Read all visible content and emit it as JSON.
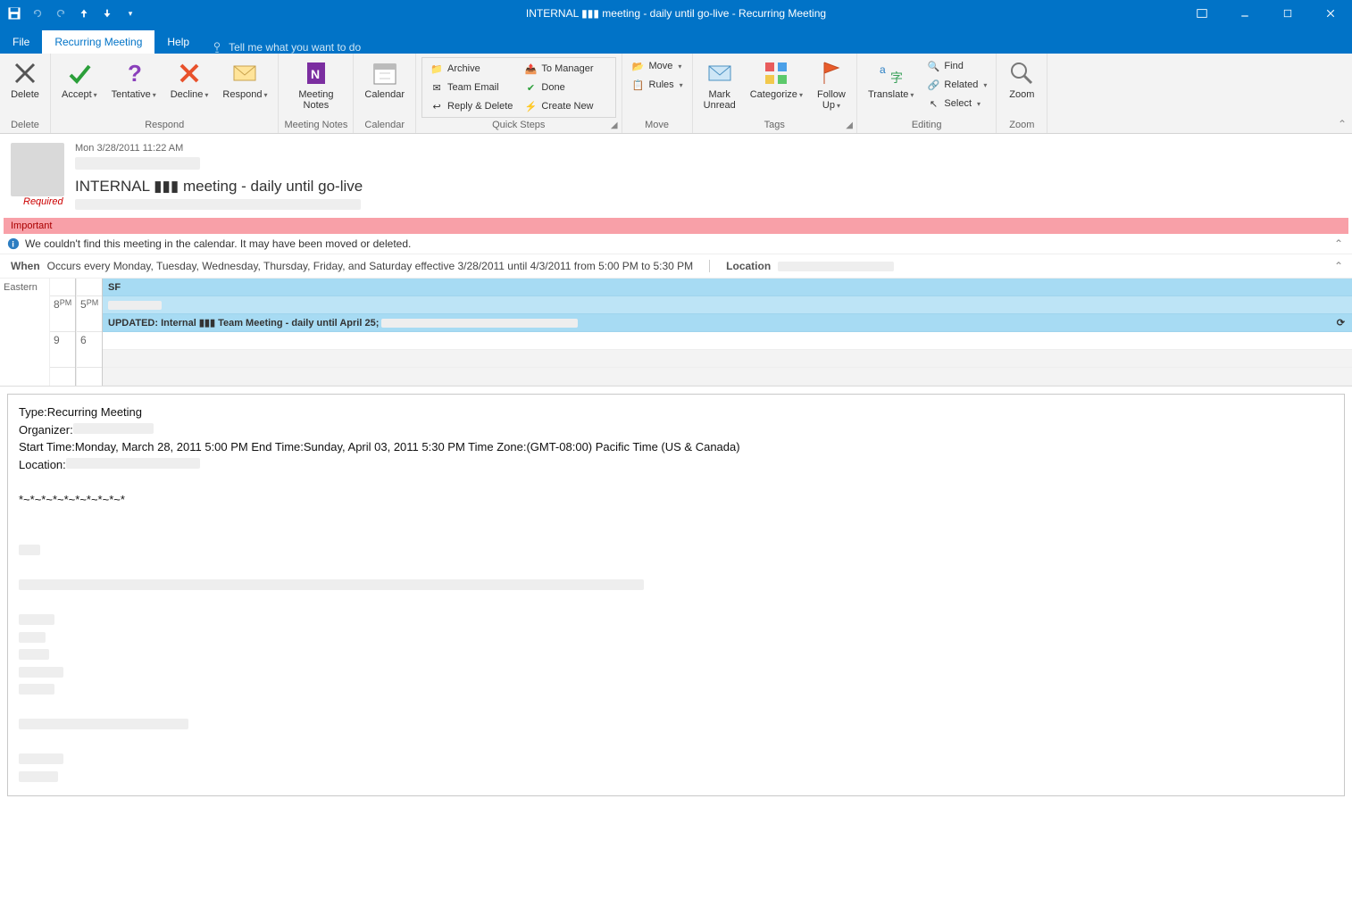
{
  "titlebar": {
    "title": "INTERNAL ▮▮▮ meeting - daily until go-live  -  Recurring Meeting"
  },
  "menu": {
    "file": "File",
    "recurring": "Recurring Meeting",
    "help": "Help",
    "tellme": "Tell me what you want to do"
  },
  "ribbon": {
    "delete": "Delete",
    "accept": "Accept",
    "tentative": "Tentative",
    "decline": "Decline",
    "respond": "Respond",
    "meeting_notes": "Meeting\nNotes",
    "calendar": "Calendar",
    "qs": {
      "archive": "Archive",
      "to_manager": "To Manager",
      "team_email": "Team Email",
      "done": "Done",
      "reply_delete": "Reply & Delete",
      "create_new": "Create New"
    },
    "move": "Move",
    "rules": "Rules",
    "mark_unread": "Mark\nUnread",
    "categorize": "Categorize",
    "follow_up": "Follow\nUp",
    "translate": "Translate",
    "find": "Find",
    "related": "Related",
    "select": "Select",
    "zoom": "Zoom",
    "groups": {
      "delete": "Delete",
      "respond": "Respond",
      "notes": "Meeting Notes",
      "calendar": "Calendar",
      "qs": "Quick Steps",
      "move": "Move",
      "tags": "Tags",
      "editing": "Editing",
      "zoom": "Zoom"
    }
  },
  "header": {
    "date": "Mon 3/28/2011 11:22 AM",
    "subject": "INTERNAL ▮▮▮ meeting - daily until go-live",
    "required": "Required"
  },
  "bars": {
    "important": "Important",
    "not_found": "We couldn't find this meeting in the calendar. It may have been moved or deleted.",
    "when_label": "When",
    "when_text": "Occurs every Monday, Tuesday, Wednesday, Thursday, Friday, and Saturday effective 3/28/2011 until 4/3/2011 from 5:00 PM to 5:30 PM",
    "location_label": "Location"
  },
  "calendar": {
    "tz_label": "Eastern",
    "tz1_hours": [
      "8",
      "9"
    ],
    "tz2_hours": [
      "5",
      "6"
    ],
    "pm": "PM",
    "evt1": "SF",
    "evt2": "UPDATED: Internal ▮▮▮ Team Meeting - daily until April 25;"
  },
  "body": {
    "type_lbl": "Type:",
    "type_val": "Recurring Meeting",
    "org_lbl": "Organizer:",
    "times": "Start Time:Monday, March 28, 2011 5:00 PM End Time:Sunday, April 03, 2011 5:30 PM Time Zone:(GMT-08:00) Pacific Time (US & Canada)",
    "loc_lbl": "Location:",
    "divider": "*~*~*~*~*~*~*~*~*~*"
  }
}
